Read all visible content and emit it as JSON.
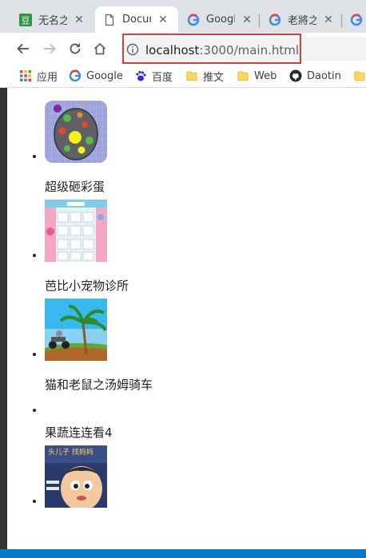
{
  "tabs": [
    {
      "title": "无名之辈",
      "favicon": "douban-icon",
      "active": false
    },
    {
      "title": "Document",
      "favicon": "page-icon",
      "active": true
    },
    {
      "title": "Google",
      "favicon": "google-icon",
      "active": false
    },
    {
      "title": "老將之死",
      "favicon": "google-icon",
      "active": false
    }
  ],
  "toolbar": {
    "url_host": "localhost",
    "url_path": ":3000/main.html"
  },
  "bookmarks": [
    {
      "label": "应用",
      "icon": "apps-grid-icon"
    },
    {
      "label": "Google",
      "icon": "google-icon"
    },
    {
      "label": "百度",
      "icon": "baidu-paw-icon"
    },
    {
      "label": "推文",
      "icon": "folder-icon"
    },
    {
      "label": "Web",
      "icon": "folder-icon"
    },
    {
      "label": "Daotin",
      "icon": "github-icon"
    }
  ],
  "games": [
    {
      "title": "超级砸彩蛋",
      "thumb": "egg-thumbnail"
    },
    {
      "title": "芭比小宠物诊所",
      "thumb": "pet-clinic-thumbnail"
    },
    {
      "title": "猫和老鼠之汤姆骑车",
      "thumb": "tom-bike-thumbnail"
    },
    {
      "title": "果蔬连连看4",
      "thumb": ""
    },
    {
      "title": "",
      "thumb": "cartoon-boy-thumbnail",
      "thumb_text": "头儿子 找妈妈"
    }
  ],
  "colors": {
    "tabstrip": "#dee1e6",
    "highlight": "#e53935",
    "statusbar": "#007acc"
  }
}
